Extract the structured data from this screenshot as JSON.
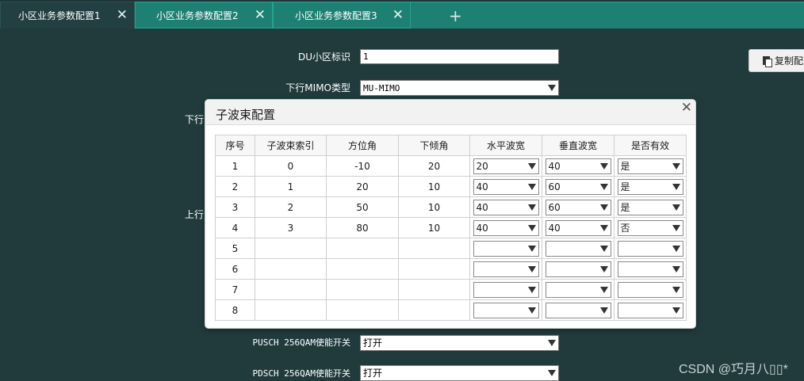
{
  "tabs": [
    {
      "label": "小区业务参数配置1",
      "active": true
    },
    {
      "label": "小区业务参数配置2",
      "active": false
    },
    {
      "label": "小区业务参数配置3",
      "active": false
    }
  ],
  "tab_add_symbol": "+",
  "tab_close_symbol": "✕",
  "form": {
    "du_cell_id": {
      "label": "DU小区标识",
      "value": "1"
    },
    "dl_mimo_type": {
      "label": "下行MIMO类型",
      "value": "MU-MIMO"
    },
    "partial_dl": "下行",
    "partial_ul": "上行",
    "pusch_256qam": {
      "label": "PUSCH 256QAM使能开关",
      "value": "打开"
    },
    "pdsch_256qam": {
      "label": "PDSCH 256QAM使能开关",
      "value": "打开"
    }
  },
  "copy_button": {
    "label": "复制配"
  },
  "modal": {
    "title": "子波束配置",
    "close_symbol": "✕",
    "columns": [
      "序号",
      "子波束索引",
      "方位角",
      "下倾角",
      "水平波宽",
      "垂直波宽",
      "是否有效"
    ],
    "rows": [
      {
        "index": "1",
        "beam_index": "0",
        "azimuth": "-10",
        "tilt": "20",
        "h_width": "20",
        "v_width": "40",
        "valid": "是"
      },
      {
        "index": "2",
        "beam_index": "1",
        "azimuth": "20",
        "tilt": "10",
        "h_width": "40",
        "v_width": "60",
        "valid": "是"
      },
      {
        "index": "3",
        "beam_index": "2",
        "azimuth": "50",
        "tilt": "10",
        "h_width": "40",
        "v_width": "60",
        "valid": "是"
      },
      {
        "index": "4",
        "beam_index": "3",
        "azimuth": "80",
        "tilt": "10",
        "h_width": "40",
        "v_width": "40",
        "valid": "否"
      },
      {
        "index": "5",
        "beam_index": "",
        "azimuth": "",
        "tilt": "",
        "h_width": "",
        "v_width": "",
        "valid": ""
      },
      {
        "index": "6",
        "beam_index": "",
        "azimuth": "",
        "tilt": "",
        "h_width": "",
        "v_width": "",
        "valid": ""
      },
      {
        "index": "7",
        "beam_index": "",
        "azimuth": "",
        "tilt": "",
        "h_width": "",
        "v_width": "",
        "valid": ""
      },
      {
        "index": "8",
        "beam_index": "",
        "azimuth": "",
        "tilt": "",
        "h_width": "",
        "v_width": "",
        "valid": ""
      }
    ]
  },
  "watermark": "CSDN @巧月八▯▯*",
  "colors": {
    "background": "#213b3d",
    "tab_active": "#223f41",
    "tab_inactive": "#1e8073"
  }
}
